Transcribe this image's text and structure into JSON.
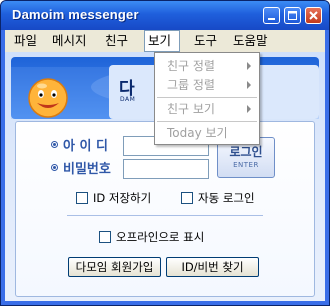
{
  "window": {
    "title": "Damoim messenger"
  },
  "menubar": {
    "items": [
      {
        "label": "파일"
      },
      {
        "label": "메시지"
      },
      {
        "label": "친구"
      },
      {
        "label": "보기"
      },
      {
        "label": "도구"
      },
      {
        "label": "도움말"
      }
    ],
    "active": "보기"
  },
  "view_menu": {
    "items": [
      {
        "label": "친구 정렬",
        "submenu": true
      },
      {
        "label": "그룹 정렬",
        "submenu": true
      },
      {
        "label": "친구 보기",
        "submenu": true
      },
      {
        "label": "Today 보기",
        "submenu": false
      }
    ]
  },
  "header": {
    "logo_title": "다",
    "logo_sub": "DAM"
  },
  "login": {
    "id_label": "아 이 디",
    "id_value": "",
    "password_label": "비밀번호",
    "password_value": "",
    "login_button": "로그인",
    "login_button_sub": "ENTER",
    "save_id_label": "ID 저장하기",
    "auto_login_label": "자동 로그인",
    "offline_label": "오프라인으로 표시",
    "join_button": "다모임 회원가입",
    "find_button": "ID/비번 찾기"
  },
  "colors": {
    "titlebar": "#1f5fdc",
    "menubar": "#ece9d8",
    "label_blue": "#3058a8",
    "panel_border": "#9fb8e0"
  }
}
